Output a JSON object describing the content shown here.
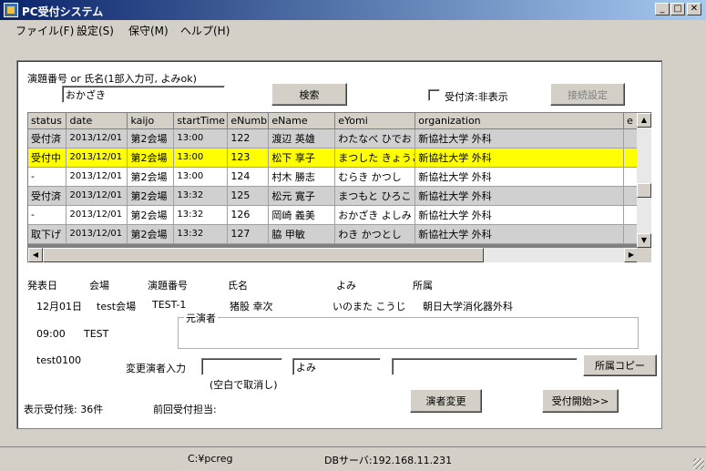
{
  "window": {
    "title": "PC受付システム"
  },
  "menu": [
    "ファイル(F)",
    "設定(S)",
    "保守(M)",
    "ヘルプ(H)"
  ],
  "search": {
    "label": "演題番号 or 氏名(1部入力可, よみok)",
    "value": "おかざき",
    "button": "検索",
    "checkbox_label": "受付済:非表示",
    "connect_button": "接続設定"
  },
  "grid": {
    "columns": [
      "status",
      "date",
      "kaijo",
      "startTime",
      "eNumb",
      "eName",
      "eYomi",
      "organization",
      "e"
    ],
    "rows": [
      {
        "style": "gray",
        "cells": [
          "受付済",
          "2013/12/01",
          "第2会場",
          "13:00",
          "122",
          "渡辺 英雄",
          "わたなべ ひでお",
          "新協社大学 外科"
        ]
      },
      {
        "style": "yellow",
        "cells": [
          "受付中",
          "2013/12/01",
          "第2会場",
          "13:00",
          "123",
          "松下 享子",
          "まつした きょうこ",
          "新協社大学 外科"
        ]
      },
      {
        "style": "white",
        "cells": [
          "-",
          "2013/12/01",
          "第2会場",
          "13:00",
          "124",
          "村木 勝志",
          "むらき かつし",
          "新協社大学 外科"
        ]
      },
      {
        "style": "gray",
        "cells": [
          "受付済",
          "2013/12/01",
          "第2会場",
          "13:32",
          "125",
          "松元 寛子",
          "まつもと ひろこ",
          "新協社大学 外科"
        ]
      },
      {
        "style": "white",
        "cells": [
          "-",
          "2013/12/01",
          "第2会場",
          "13:32",
          "126",
          "岡崎 義美",
          "おかざき よしみ",
          "新協社大学 外科"
        ]
      },
      {
        "style": "gray",
        "cells": [
          "取下げ",
          "2013/12/01",
          "第2会場",
          "13:32",
          "127",
          "脇 甲敏",
          "わき かつとし",
          "新協社大学 外科"
        ]
      }
    ]
  },
  "detail": {
    "headers": {
      "date": "発表日",
      "venue": "会場",
      "number": "演題番号",
      "name": "氏名",
      "yomi": "よみ",
      "org": "所属"
    },
    "values": {
      "date": "12月01日",
      "venue": "test会場",
      "number": "TEST-1",
      "name": "猪股 幸次",
      "yomi": "いのまた こうじ",
      "org": "朝日大学消化器外科"
    },
    "time": "09:00",
    "session": "TEST",
    "code": "test0100",
    "group_label": "元演者",
    "change_label": "変更演者入力",
    "change_name": "",
    "change_yomi": "よみ",
    "change_org": "",
    "org_copy_button": "所属コピー",
    "blank_note": "(空白で取消し)",
    "remaining": "表示受付残: 36件",
    "last_staff": "前回受付担当:",
    "change_button": "演者変更",
    "start_button": "受付開始>>"
  },
  "status": {
    "path": "C:¥pcreg",
    "server": "DBサーバ:192.168.11.231"
  }
}
